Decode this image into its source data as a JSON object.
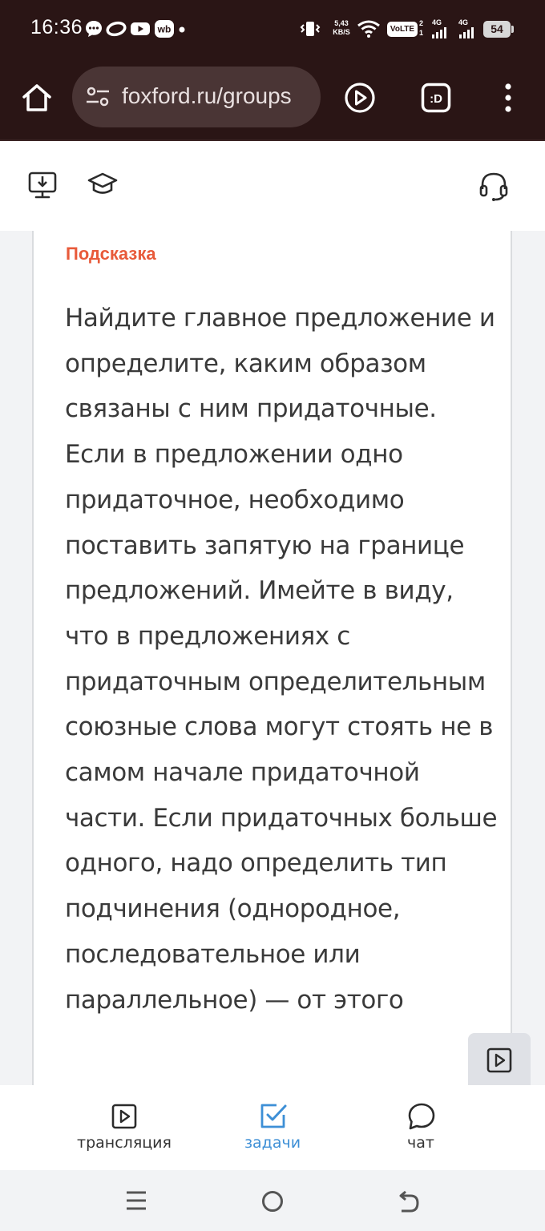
{
  "status_bar": {
    "time": "16:36",
    "net_speed_value": "5,43",
    "net_speed_unit": "KB/S",
    "volte": "VoLTE",
    "sim1_label": "4G",
    "sim2_label": "4G",
    "sim1_slot": "1",
    "sim2_slot": "2",
    "battery": "54",
    "icons": [
      "chat-bubble-icon",
      "oval-app-icon",
      "youtube-icon",
      "wb-icon",
      "dot-icon",
      "vibrate-icon",
      "wifi-icon",
      "signal-icon",
      "battery-icon"
    ]
  },
  "browser": {
    "url": "foxford.ru/groups",
    "icons": [
      "home-icon",
      "site-settings-icon",
      "play-circle-icon",
      "tab-switcher-icon",
      "more-vert-icon"
    ],
    "tab_switcher_label": ":D"
  },
  "toolbar": {
    "icons": [
      "download-monitor-icon",
      "graduation-cap-icon",
      "headset-icon"
    ]
  },
  "hint": {
    "title": "Подсказка",
    "text": "Найдите главное предложение и определите, каким образом связаны с ним придаточные. Если в предложении одно придаточное, необходимо поставить запятую на границе предложений. Имейте в виду, что в предложениях с придаточным определительным союзные слова могут стоять не в самом начале придаточной части. Если придаточных больше одного, надо определить тип подчинения (однородное, последовательное или параллельное) — от этого"
  },
  "bottom_tabs": [
    {
      "label": "трансляция",
      "icon": "video-play-icon",
      "active": false
    },
    {
      "label": "задачи",
      "icon": "checkbox-icon",
      "active": true
    },
    {
      "label": "чат",
      "icon": "chat-icon",
      "active": false
    }
  ],
  "colors": {
    "browser_bg": "#2a1515",
    "accent_orange": "#e85a3a",
    "accent_blue": "#3d8fd6"
  },
  "system_nav": {
    "icons": [
      "menu-icon",
      "home-circle-icon",
      "back-icon"
    ]
  }
}
